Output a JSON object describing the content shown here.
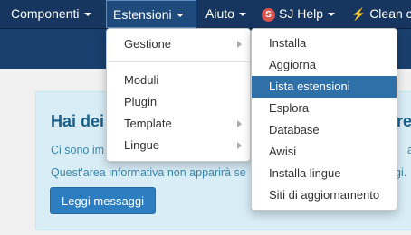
{
  "nav": {
    "componenti": "Componenti",
    "estensioni": "Estensioni",
    "aiuto": "Aiuto",
    "sj_badge": "S",
    "sj_help": "SJ Help",
    "clean": "Clean c"
  },
  "menu_estensioni": {
    "gestione": "Gestione",
    "moduli": "Moduli",
    "plugin": "Plugin",
    "template": "Template",
    "lingue": "Lingue"
  },
  "submenu_gestione": {
    "items": [
      "Installa",
      "Aggiorna",
      "Lista estensioni",
      "Esplora",
      "Database",
      "Awisi",
      "Installa lingue",
      "Siti di aggiornamento"
    ],
    "active_index": 2
  },
  "alert": {
    "title": "Hai dei",
    "title_right": "re",
    "line1": "Ci sono im",
    "line1_right": "a",
    "line2": "Quest'area informativa non apparirà se",
    "line2_right": "gi.",
    "button": "Leggi messaggi"
  },
  "colors": {
    "navbar": "#17365f",
    "active_item": "#2f70a8",
    "alert_bg": "#d9edf7",
    "button": "#2d7dc1"
  }
}
